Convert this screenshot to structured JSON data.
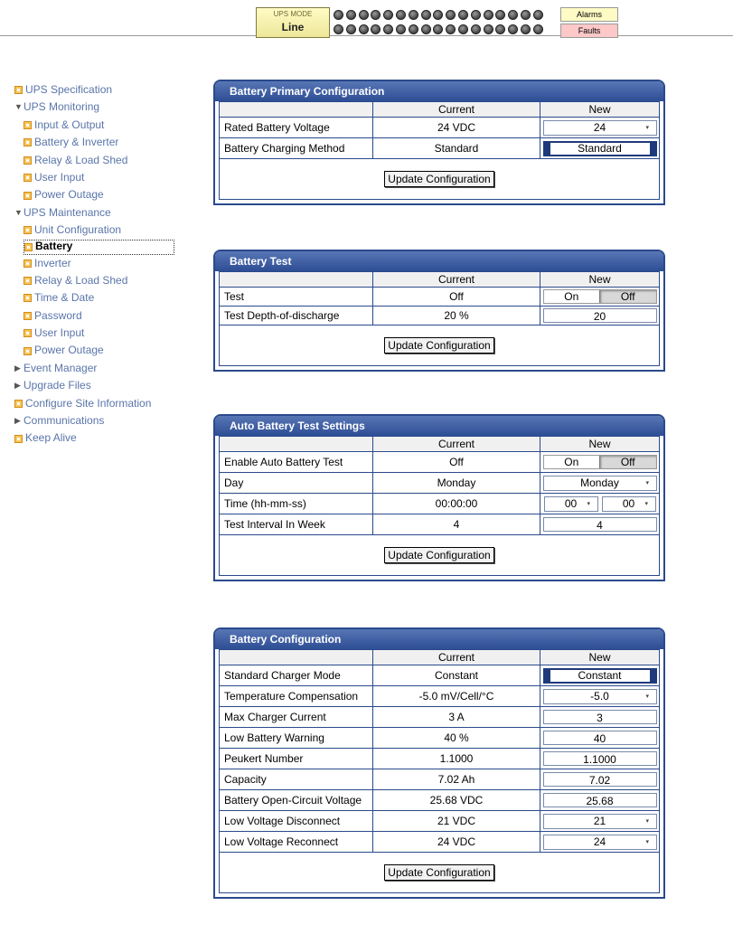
{
  "status": {
    "ups_mode_label": "UPS MODE",
    "ups_mode_value": "Line",
    "alarms_label": "Alarms",
    "faults_label": "Faults",
    "alarm_colors": {
      "alarms": "#fffbc4",
      "faults": "#fcc8c8"
    }
  },
  "sidebar": {
    "items": [
      {
        "label": "UPS Specification",
        "type": "icon"
      },
      {
        "label": "UPS Monitoring",
        "type": "expanded"
      },
      {
        "label": "Input & Output",
        "type": "sub"
      },
      {
        "label": "Battery & Inverter",
        "type": "sub"
      },
      {
        "label": "Relay & Load Shed",
        "type": "sub"
      },
      {
        "label": "User Input",
        "type": "sub"
      },
      {
        "label": "Power Outage",
        "type": "sub"
      },
      {
        "label": "UPS Maintenance",
        "type": "expanded"
      },
      {
        "label": "Unit Configuration",
        "type": "sub"
      },
      {
        "label": "Battery",
        "type": "active"
      },
      {
        "label": "Inverter",
        "type": "sub"
      },
      {
        "label": "Relay & Load Shed",
        "type": "sub"
      },
      {
        "label": "Time & Date",
        "type": "sub"
      },
      {
        "label": "Password",
        "type": "sub"
      },
      {
        "label": "User Input",
        "type": "sub"
      },
      {
        "label": "Power Outage",
        "type": "sub"
      },
      {
        "label": "Event Manager",
        "type": "collapsed"
      },
      {
        "label": "Upgrade Files",
        "type": "collapsed"
      },
      {
        "label": "Configure Site Information",
        "type": "icon"
      },
      {
        "label": "Communications",
        "type": "collapsed"
      },
      {
        "label": "Keep Alive",
        "type": "icon"
      }
    ]
  },
  "common": {
    "col_current": "Current",
    "col_new": "New",
    "update_button": "Update Configuration"
  },
  "primary": {
    "title": "Battery Primary Configuration",
    "rated_voltage": {
      "label": "Rated Battery Voltage",
      "current": "24 VDC",
      "new": "24"
    },
    "charging_method": {
      "label": "Battery Charging Method",
      "current": "Standard",
      "new": "Standard"
    }
  },
  "test": {
    "title": "Battery Test",
    "test": {
      "label": "Test",
      "current": "Off",
      "on": "On",
      "off": "Off"
    },
    "depth": {
      "label": "Test Depth-of-discharge",
      "current": "20 %",
      "new": "20"
    }
  },
  "auto": {
    "title": "Auto Battery Test Settings",
    "enable": {
      "label": "Enable Auto Battery Test",
      "current": "Off",
      "on": "On",
      "off": "Off"
    },
    "day": {
      "label": "Day",
      "current": "Monday",
      "new": "Monday"
    },
    "time": {
      "label": "Time (hh-mm-ss)",
      "current": "00:00:00",
      "hh": "00",
      "mm": "00"
    },
    "interval": {
      "label": "Test Interval In Week",
      "current": "4",
      "new": "4"
    }
  },
  "config": {
    "title": "Battery Configuration",
    "charger_mode": {
      "label": "Standard Charger Mode",
      "current": "Constant",
      "new": "Constant"
    },
    "temp_comp": {
      "label": "Temperature Compensation",
      "current": "-5.0 mV/Cell/°C",
      "new": "-5.0"
    },
    "max_current": {
      "label": "Max Charger Current",
      "current": "3 A",
      "new": "3"
    },
    "low_warning": {
      "label": "Low Battery Warning",
      "current": "40 %",
      "new": "40"
    },
    "peukert": {
      "label": "Peukert Number",
      "current": "1.1000",
      "new": "1.1000"
    },
    "capacity": {
      "label": "Capacity",
      "current": "7.02 Ah",
      "new": "7.02"
    },
    "ocv": {
      "label": "Battery Open-Circuit Voltage",
      "current": "25.68 VDC",
      "new": "25.68"
    },
    "lv_disconnect": {
      "label": "Low Voltage Disconnect",
      "current": "21 VDC",
      "new": "21"
    },
    "lv_reconnect": {
      "label": "Low Voltage Reconnect",
      "current": "24 VDC",
      "new": "24"
    }
  }
}
